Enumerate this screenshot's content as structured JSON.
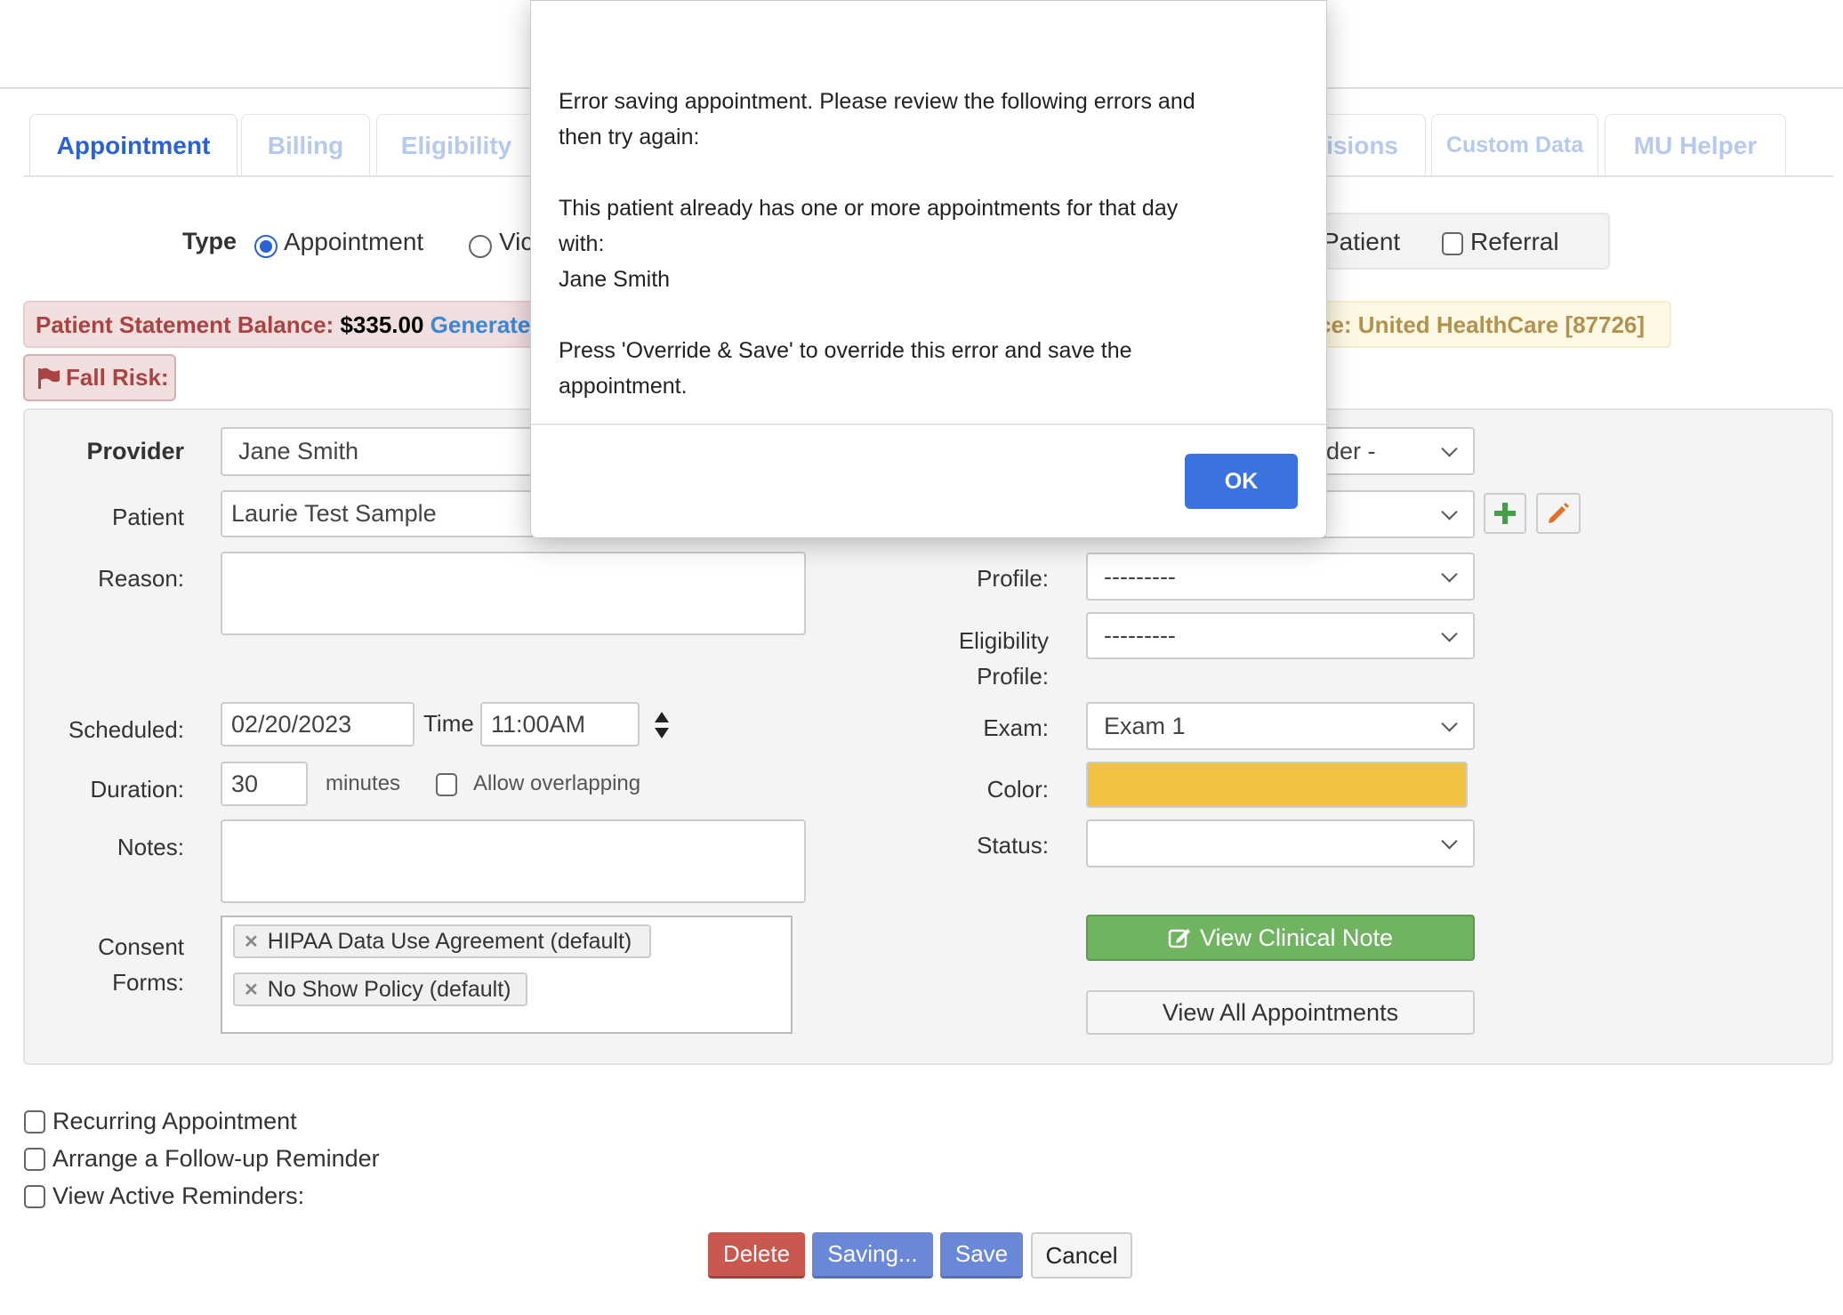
{
  "tabs": [
    {
      "label": "Appointment",
      "active": true
    },
    {
      "label": "Billing"
    },
    {
      "label": "Eligibility"
    },
    {
      "label": "isions"
    },
    {
      "label": "Custom Data"
    },
    {
      "label": "MU Helper"
    }
  ],
  "type_row": {
    "label": "Type",
    "options": [
      {
        "label": "Appointment",
        "checked": true
      },
      {
        "label": "Vic",
        "checked": false
      }
    ],
    "patient_fragment": "Patient",
    "referral_label": "Referral"
  },
  "balance": {
    "label": "Patient Statement Balance:",
    "amount": "$335.00",
    "link": "Generate"
  },
  "insurance": {
    "text": "ce: United HealthCare [87726]"
  },
  "fall_risk": {
    "label": "Fall Risk:",
    "icon": "flag-icon"
  },
  "form": {
    "provider_label": "Provider",
    "provider_value": "Jane Smith",
    "patient_label": "Patient",
    "patient_value": "Laurie Test Sample",
    "reason_label": "Reason:",
    "scheduled_label": "Scheduled:",
    "date_value": "02/20/2023",
    "time_label": "Time",
    "time_value": "11:00AM",
    "duration_label": "Duration:",
    "duration_value": "30",
    "minutes_label": "minutes",
    "allow_overlap_label": "Allow overlapping",
    "notes_label": "Notes:",
    "consent_label_1": "Consent",
    "consent_label_2": "Forms:",
    "consent_tags": [
      "HIPAA Data Use Agreement (default)",
      "No Show Policy (default)"
    ],
    "right_provider_fragment": "der -",
    "profile_label": "Profile:",
    "profile_value": "---------",
    "elig_label_1": "Eligibility",
    "elig_label_2": "Profile:",
    "elig_value": "---------",
    "exam_label": "Exam:",
    "exam_value": "Exam 1",
    "color_label": "Color:",
    "color_value": "#f3c242",
    "status_label": "Status:",
    "status_value": "",
    "view_note": "View Clinical Note",
    "view_all": "View All Appointments"
  },
  "options": [
    "Recurring Appointment",
    "Arrange a Follow-up Reminder",
    "View Active Reminders:"
  ],
  "actions": {
    "delete": "Delete",
    "saving": "Saving...",
    "save": "Save",
    "cancel": "Cancel"
  },
  "modal": {
    "lines": [
      "Error saving appointment. Please review the following errors and",
      "then try again:",
      "This patient already has one or more appointments for that day",
      "with:",
      "Jane Smith",
      "Press 'Override & Save' to override this error and save the",
      "appointment."
    ],
    "ok": "OK"
  },
  "colors": {
    "accent": "#2a62d4",
    "ok_button": "#3a73df",
    "success": "#70b462",
    "danger": "#c9584f",
    "primary": "#6b88d8"
  }
}
